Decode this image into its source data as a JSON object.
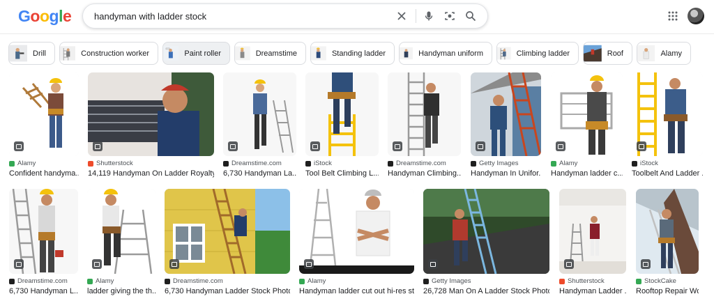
{
  "logo": {
    "letters": [
      "G",
      "o",
      "o",
      "g",
      "l",
      "e"
    ],
    "colors": [
      "#4285F4",
      "#EA4335",
      "#FBBC05",
      "#4285F4",
      "#34A853",
      "#EA4335"
    ]
  },
  "search": {
    "query": "handyman with ladder stock"
  },
  "icons": {
    "clear": "close-icon",
    "voice": "microphone-icon",
    "lens": "lens-camera-icon",
    "search": "search-icon",
    "apps": "apps-grid-icon"
  },
  "chips": [
    {
      "label": "Drill"
    },
    {
      "label": "Construction worker"
    },
    {
      "label": "Paint roller"
    },
    {
      "label": "Dreamstime"
    },
    {
      "label": "Standing ladder"
    },
    {
      "label": "Handyman uniform"
    },
    {
      "label": "Climbing ladder"
    },
    {
      "label": "Roof"
    },
    {
      "label": "Alamy"
    }
  ],
  "results": [
    {
      "source": "Alamy",
      "title": "Confident handyma...",
      "fav": "#34a853"
    },
    {
      "source": "Shutterstock",
      "title": "14,119 Handyman On Ladder Royalty-...",
      "fav": "#ee4b2b"
    },
    {
      "source": "Dreamstime.com",
      "title": "6,730 Handyman La...",
      "fav": "#1f1f1f"
    },
    {
      "source": "iStock",
      "title": "Tool Belt Climbing L...",
      "fav": "#1f1f1f"
    },
    {
      "source": "Dreamstime.com",
      "title": "Handyman Climbing...",
      "fav": "#1f1f1f"
    },
    {
      "source": "Getty Images",
      "title": "Handyman In Unifor...",
      "fav": "#1f1f1f"
    },
    {
      "source": "Alamy",
      "title": "Handyman ladder c...",
      "fav": "#34a853"
    },
    {
      "source": "iStock",
      "title": "Toolbelt And Ladder ...",
      "fav": "#1f1f1f"
    },
    {
      "source": "Dreamstime.com",
      "title": "6,730 Handyman L...",
      "fav": "#1f1f1f"
    },
    {
      "source": "Alamy",
      "title": "ladder giving the th...",
      "fav": "#34a853"
    },
    {
      "source": "Dreamstime.com",
      "title": "6,730 Handyman Ladder Stock Photo...",
      "fav": "#1f1f1f"
    },
    {
      "source": "Alamy",
      "title": "Handyman ladder cut out hi-res st...",
      "fav": "#34a853"
    },
    {
      "source": "Getty Images",
      "title": "26,728 Man On A Ladder Stock Photo...",
      "fav": "#1f1f1f"
    },
    {
      "source": "Shutterstock",
      "title": "Handyman Ladder ...",
      "fav": "#ee4b2b"
    },
    {
      "source": "StockCake",
      "title": "Rooftop Repair Wo...",
      "fav": "#34a853"
    }
  ]
}
